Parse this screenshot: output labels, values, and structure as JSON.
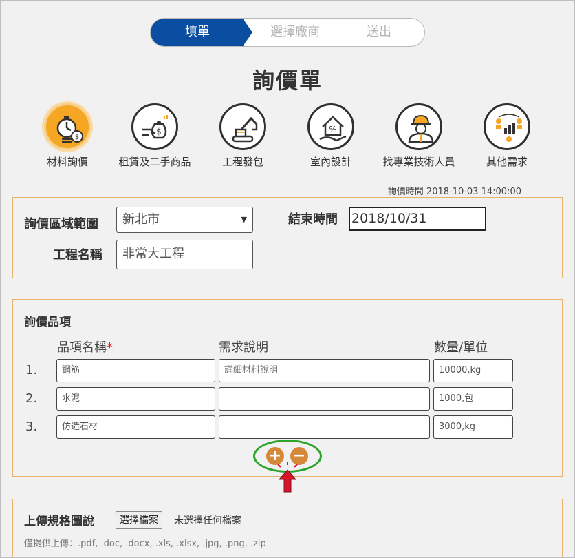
{
  "stepper": {
    "steps": [
      "填單",
      "選擇廠商",
      "送出"
    ],
    "active_index": 0
  },
  "page_title": "詢價單",
  "categories": [
    {
      "label": "材料詢價",
      "icon": "timer-coins-icon",
      "active": true
    },
    {
      "label": "租賃及二手商品",
      "icon": "money-bag-hand-icon",
      "active": false
    },
    {
      "label": "工程發包",
      "icon": "excavator-icon",
      "active": false
    },
    {
      "label": "室內設計",
      "icon": "house-hand-icon",
      "active": false
    },
    {
      "label": "找專業技術人員",
      "icon": "worker-icon",
      "active": false
    },
    {
      "label": "其他需求",
      "icon": "chart-people-icon",
      "active": false
    }
  ],
  "query_time": "詢價時間  2018-10-03 14:00:00",
  "form": {
    "region_label": "詢價區域範圍",
    "region_value": "新北市",
    "end_time_label": "結束時間",
    "end_time_value": "2018/10/31",
    "project_label": "工程名稱",
    "project_value": "非常大工程"
  },
  "items": {
    "section_title": "詢價品項",
    "headers": {
      "name": "品項名稱",
      "required_mark": "*",
      "desc": "需求說明",
      "qty": "數量/單位"
    },
    "rows": [
      {
        "num": "1.",
        "name": "鋼筋",
        "desc": "",
        "desc_placeholder": "詳細材料說明",
        "qty": "10000,kg"
      },
      {
        "num": "2.",
        "name": "水泥",
        "desc": "",
        "desc_placeholder": "",
        "qty": "1000,包"
      },
      {
        "num": "3.",
        "name": "仿造石材",
        "desc": "",
        "desc_placeholder": "",
        "qty": "3000,kg"
      }
    ],
    "add_symbol": "+",
    "remove_symbol": "−"
  },
  "upload": {
    "title": "上傳規格圖說",
    "button_label": "選擇檔案",
    "no_file_text": "未選擇任何檔案",
    "hint": "僅提供上傳：.pdf, .doc, .docx, .xls, .xlsx, .jpg, .png, .zip"
  },
  "colors": {
    "primary": "#0a4ea2",
    "accent": "#f5a623",
    "panel_border": "#e6b36a",
    "highlight": "#2da52d",
    "pointer": "#d4142a",
    "add_remove": "#d4883a"
  }
}
